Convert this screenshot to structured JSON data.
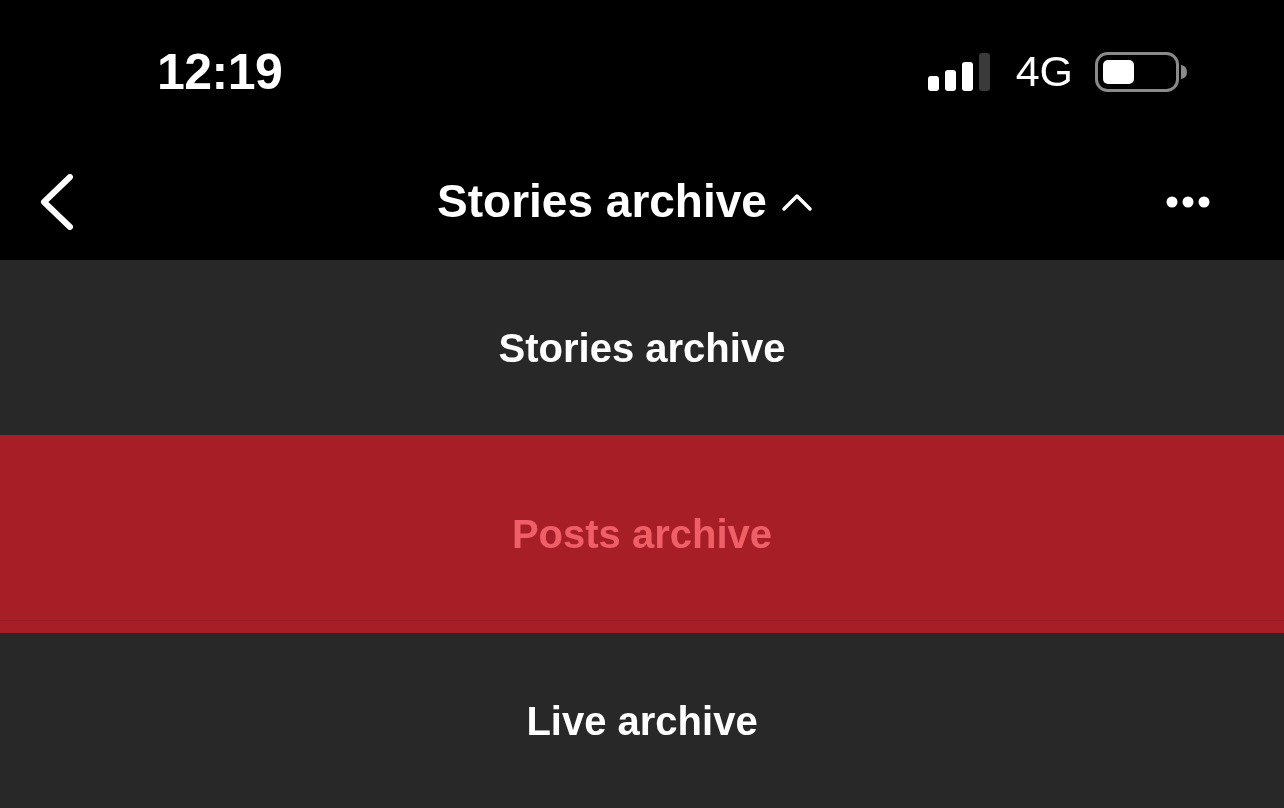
{
  "status_bar": {
    "time": "12:19",
    "network": "4G"
  },
  "nav_bar": {
    "title": "Stories archive",
    "expanded": true
  },
  "menu": [
    {
      "label": "Stories archive",
      "selected": false
    },
    {
      "label": "Posts archive",
      "selected": true
    },
    {
      "label": "Live archive",
      "selected": false
    }
  ]
}
